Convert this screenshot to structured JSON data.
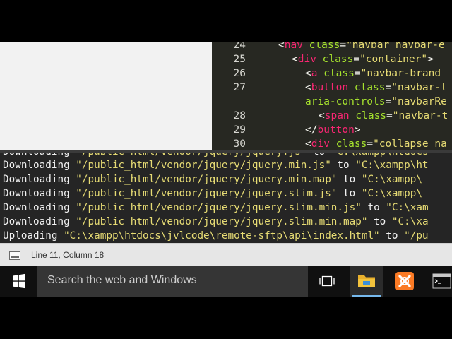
{
  "editor": {
    "lines": [
      {
        "num": "24",
        "indent": 0,
        "parts": [
          [
            "p",
            "<"
          ],
          [
            "t",
            "nav"
          ],
          [
            "p",
            " "
          ],
          [
            "a",
            "class"
          ],
          [
            "p",
            "="
          ],
          [
            "s",
            "\"navbar navbar-e"
          ]
        ]
      },
      {
        "num": "25",
        "indent": 1,
        "parts": [
          [
            "p",
            "<"
          ],
          [
            "t",
            "div"
          ],
          [
            "p",
            " "
          ],
          [
            "a",
            "class"
          ],
          [
            "p",
            "="
          ],
          [
            "s",
            "\"container\""
          ],
          [
            "p",
            ">"
          ]
        ]
      },
      {
        "num": "26",
        "indent": 2,
        "parts": [
          [
            "p",
            "<"
          ],
          [
            "t",
            "a"
          ],
          [
            "p",
            " "
          ],
          [
            "a",
            "class"
          ],
          [
            "p",
            "="
          ],
          [
            "s",
            "\"navbar-brand"
          ]
        ]
      },
      {
        "num": "27",
        "indent": 2,
        "parts": [
          [
            "p",
            "<"
          ],
          [
            "t",
            "button"
          ],
          [
            "p",
            " "
          ],
          [
            "a",
            "class"
          ],
          [
            "p",
            "="
          ],
          [
            "s",
            "\"navbar-t"
          ]
        ]
      },
      {
        "num": "",
        "indent": 2,
        "parts": [
          [
            "a",
            "aria-controls"
          ],
          [
            "p",
            "="
          ],
          [
            "s",
            "\"navbarRe"
          ]
        ]
      },
      {
        "num": "28",
        "indent": 3,
        "parts": [
          [
            "p",
            "<"
          ],
          [
            "t",
            "span"
          ],
          [
            "p",
            " "
          ],
          [
            "a",
            "class"
          ],
          [
            "p",
            "="
          ],
          [
            "s",
            "\"navbar-t"
          ]
        ]
      },
      {
        "num": "29",
        "indent": 2,
        "parts": [
          [
            "p",
            "</"
          ],
          [
            "t",
            "button"
          ],
          [
            "p",
            ">"
          ]
        ]
      },
      {
        "num": "30",
        "indent": 2,
        "parts": [
          [
            "p",
            "<"
          ],
          [
            "t",
            "div"
          ],
          [
            "p",
            " "
          ],
          [
            "a",
            "class"
          ],
          [
            "p",
            "="
          ],
          [
            "s",
            "\"collapse na"
          ]
        ]
      }
    ]
  },
  "terminal": {
    "lines": [
      {
        "action": "Downloading",
        "source": "\"/public_html/vendor/jquery/jquery.js\"",
        "target": "\"C:\\xampp\\htdocs"
      },
      {
        "action": "Downloading",
        "source": "\"/public_html/vendor/jquery/jquery.min.js\"",
        "target": "\"C:\\xampp\\ht"
      },
      {
        "action": "Downloading",
        "source": "\"/public_html/vendor/jquery/jquery.min.map\"",
        "target": "\"C:\\xampp\\"
      },
      {
        "action": "Downloading",
        "source": "\"/public_html/vendor/jquery/jquery.slim.js\"",
        "target": "\"C:\\xampp\\"
      },
      {
        "action": "Downloading",
        "source": "\"/public_html/vendor/jquery/jquery.slim.min.js\"",
        "target": "\"C:\\xam"
      },
      {
        "action": "Downloading",
        "source": "\"/public_html/vendor/jquery/jquery.slim.min.map\"",
        "target": "\"C:\\xa"
      },
      {
        "action": "Uploading",
        "source": "\"C:\\xampp\\htdocs\\jvlcode\\remote-sftp\\api\\index.html\"",
        "target": "\"/pu"
      }
    ],
    "connector": "to"
  },
  "status_bar": {
    "position": "Line 11, Column 18",
    "panel_icon": "panel-toggle-icon"
  },
  "taskbar": {
    "start_icon": "windows-logo-icon",
    "search_placeholder": "Search the web and Windows",
    "task_view_icon": "task-view-icon",
    "pinned": [
      {
        "name": "file-explorer-icon",
        "active": true
      },
      {
        "name": "xampp-icon",
        "active": false
      },
      {
        "name": "command-prompt-icon",
        "active": false
      }
    ]
  },
  "colors": {
    "editor_bg": "#272822",
    "tag": "#f92672",
    "attr": "#a6e22e",
    "string": "#e6db74",
    "terminal_bg": "#252525",
    "xampp": "#fb7a24",
    "explorer": "#f3c33d",
    "taskbar_accent": "#76b9ed"
  }
}
